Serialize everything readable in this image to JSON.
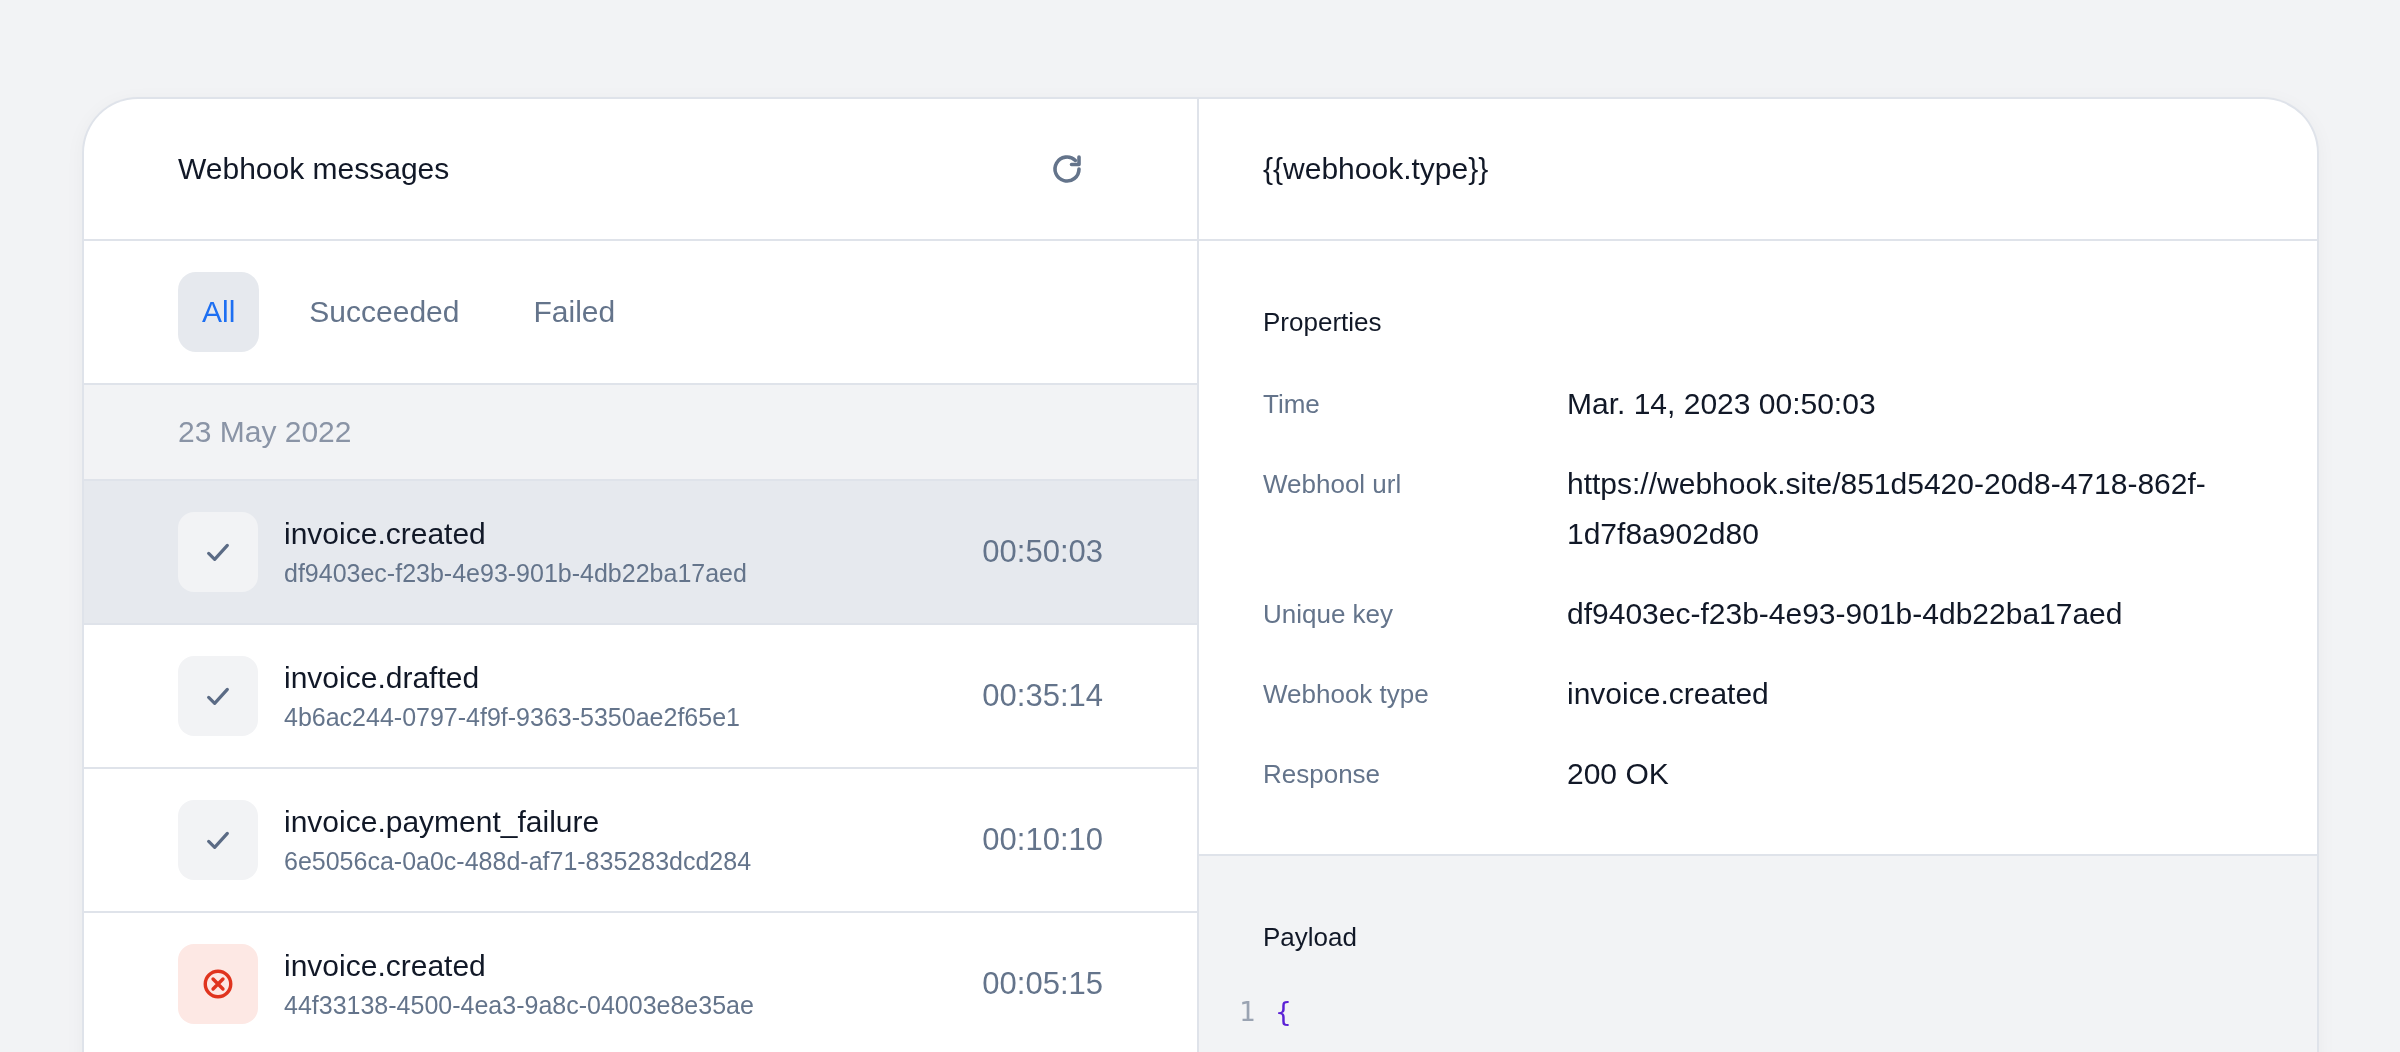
{
  "messages_panel": {
    "title": "Webhook messages",
    "tabs": [
      {
        "label": "All",
        "selected": true
      },
      {
        "label": "Succeeded",
        "selected": false
      },
      {
        "label": "Failed",
        "selected": false
      }
    ],
    "date_group": "23 May 2022",
    "rows": [
      {
        "event": "invoice.created",
        "id": "df9403ec-f23b-4e93-901b-4db22ba17aed",
        "time": "00:50:03",
        "kind": "success",
        "selected": true
      },
      {
        "event": "invoice.drafted",
        "id": "4b6ac244-0797-4f9f-9363-5350ae2f65e1",
        "time": "00:35:14",
        "kind": "success",
        "selected": false
      },
      {
        "event": "invoice.payment_failure",
        "id": "6e5056ca-0a0c-488d-af71-835283dcd284",
        "time": "00:10:10",
        "kind": "success",
        "selected": false
      },
      {
        "event": "invoice.created",
        "id": "44f33138-4500-4ea3-9a8c-04003e8e35ae",
        "time": "00:05:15",
        "kind": "failed",
        "selected": false
      }
    ]
  },
  "detail_panel": {
    "title": "{{webhook.type}}",
    "properties_heading": "Properties",
    "properties": [
      {
        "label": "Time",
        "value": "Mar. 14, 2023 00:50:03"
      },
      {
        "label": "Webhool url",
        "value": "https://webhook.site/851d5420-20d8-4718-862f-1d7f8a902d80"
      },
      {
        "label": "Unique key",
        "value": "df9403ec-f23b-4e93-901b-4db22ba17aed"
      },
      {
        "label": "Webhook type",
        "value": "invoice.created"
      },
      {
        "label": "Response",
        "value": "200 OK"
      }
    ],
    "payload_heading": "Payload",
    "payload_lines": [
      {
        "number": "1",
        "code": "{"
      }
    ]
  }
}
